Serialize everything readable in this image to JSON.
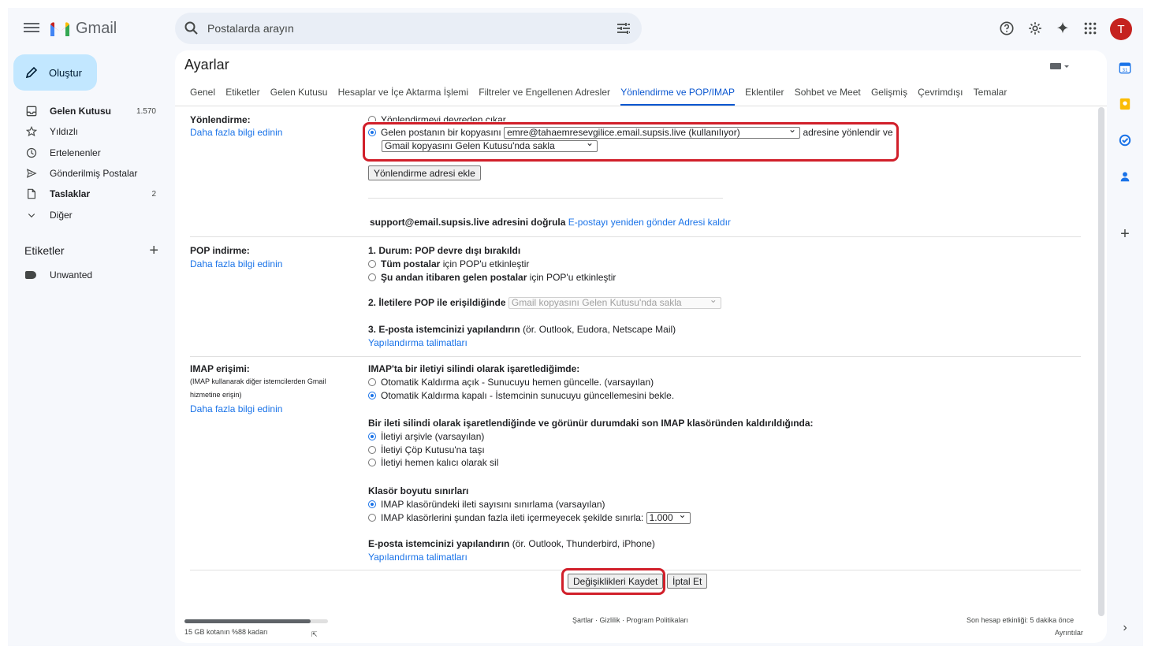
{
  "app": {
    "name": "Gmail"
  },
  "search": {
    "placeholder": "Postalarda arayın"
  },
  "avatar": {
    "initial": "T"
  },
  "compose": {
    "label": "Oluştur"
  },
  "nav": {
    "items": [
      {
        "label": "Gelen Kutusu",
        "count": "1.570",
        "icon": "inbox-icon"
      },
      {
        "label": "Yıldızlı",
        "count": "",
        "icon": "star-icon"
      },
      {
        "label": "Ertelenenler",
        "count": "",
        "icon": "clock-icon"
      },
      {
        "label": "Gönderilmiş Postalar",
        "count": "",
        "icon": "send-icon"
      },
      {
        "label": "Taslaklar",
        "count": "2",
        "icon": "draft-icon"
      },
      {
        "label": "Diğer",
        "count": "",
        "icon": "chevron-down-icon"
      }
    ]
  },
  "labels": {
    "title": "Etiketler",
    "items": [
      {
        "label": "Unwanted"
      }
    ]
  },
  "settings": {
    "title": "Ayarlar",
    "tabs": [
      "Genel",
      "Etiketler",
      "Gelen Kutusu",
      "Hesaplar ve İçe Aktarma İşlemi",
      "Filtreler ve Engellenen Adresler",
      "Yönlendirme ve POP/IMAP",
      "Eklentiler",
      "Sohbet ve Meet",
      "Gelişmiş",
      "Çevrimdışı",
      "Temalar"
    ],
    "active_tab": "Yönlendirme ve POP/IMAP"
  },
  "forwarding": {
    "label": "Yönlendirme:",
    "learn_more": "Daha fazla bilgi edinin",
    "option_disable": "Yönlendirmeyi devreden çıkar",
    "option_forward_prefix": "Gelen postanın bir kopyasını",
    "forward_address": "emre@tahaemresevgilice.email.supsis.live (kullanılıyor)",
    "option_forward_suffix": "adresine yönlendir ve",
    "keep_option": "Gmail kopyasını Gelen Kutusu'nda sakla",
    "add_button": "Yönlendirme adresi ekle",
    "verify_address": "support@email.supsis.live adresini doğrula",
    "resend_link": "E-postayı yeniden gönder",
    "remove_link": "Adresi kaldır"
  },
  "pop": {
    "label": "POP indirme:",
    "learn_more": "Daha fazla bilgi edinin",
    "status": "1. Durum: POP devre dışı bırakıldı",
    "opt_all_bold": "Tüm postalar",
    "opt_all_rest": "için POP'u etkinleştir",
    "opt_now_bold": "Şu andan itibaren gelen postalar",
    "opt_now_rest": "için POP'u etkinleştir",
    "access_label": "2. İletilere POP ile erişildiğinde",
    "access_select": "Gmail kopyasını Gelen Kutusu'nda sakla",
    "configure_bold": "3. E-posta istemcinizi yapılandırın",
    "configure_rest": "(ör. Outlook, Eudora, Netscape Mail)",
    "configure_link": "Yapılandırma talimatları"
  },
  "imap": {
    "label": "IMAP erişimi:",
    "sublabel_line1": "(IMAP kullanarak diğer istemcilerden Gmail",
    "sublabel_line2": "hizmetine erişin)",
    "learn_more": "Daha fazla bilgi edinin",
    "delete_heading": "IMAP'ta bir iletiyi silindi olarak işaretlediğimde:",
    "auto_on": "Otomatik Kaldırma açık - Sunucuyu hemen güncelle. (varsayılan)",
    "auto_off": "Otomatik Kaldırma kapalı - İstemcinin sunucuyu güncellemesini bekle.",
    "expunge_heading": "Bir ileti silindi olarak işaretlendiğinde ve görünür durumdaki son IMAP klasöründen kaldırıldığında:",
    "archive": "İletiyi arşivle (varsayılan)",
    "trash": "İletiyi Çöp Kutusu'na taşı",
    "delete_forever": "İletiyi hemen kalıcı olarak sil",
    "folder_heading": "Klasör boyutu sınırları",
    "no_limit": "IMAP klasöründeki ileti sayısını sınırlama (varsayılan)",
    "limit": "IMAP klasörlerini şundan fazla ileti içermeyecek şekilde sınırla:",
    "limit_value": "1.000",
    "configure_bold": "E-posta istemcinizi yapılandırın",
    "configure_rest": "(ör. Outlook, Thunderbird, iPhone)",
    "configure_link": "Yapılandırma talimatları"
  },
  "actions": {
    "save": "Değişiklikleri Kaydet",
    "cancel": "İptal Et"
  },
  "footer": {
    "storage": "15 GB kotanın %88 kadarı",
    "storage_fraction": 0.88,
    "links": "Şartlar · Gizlilik · Program Politikaları",
    "activity": "Son hesap etkinliği: 5 dakika önce",
    "details": "Ayrıntılar"
  },
  "colors": {
    "accent": "#0b57d0",
    "highlight": "#d11f2a",
    "compose_bg": "#c2e7ff"
  }
}
